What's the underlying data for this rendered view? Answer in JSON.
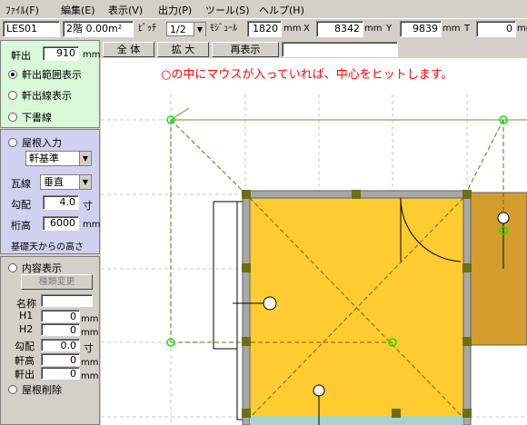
{
  "menu": {
    "file": "ﾌｧｲﾙ(F)",
    "edit": "編集(E)",
    "view": "表示(V)",
    "output": "出力(P)",
    "tools": "ツール(S)",
    "help": "ヘルプ(H)"
  },
  "status": {
    "layer": "LES01",
    "floor": "2階 0.00m²",
    "pitch_label": "ﾋﾟｯﾁ",
    "pitch_value": "1/2",
    "module_label": "ﾓｼﾞｭｰﾙ",
    "module_value": "1820",
    "x_label": "X",
    "x_value": "8342",
    "y_label": "Y",
    "y_value": "9839",
    "t_label": "T",
    "t_value": "0",
    "unit": "mm"
  },
  "toolbar": {
    "all": "全 体",
    "zoom": "拡 大",
    "redraw": "再表示"
  },
  "panel1": {
    "eave_label": "軒出",
    "eave_value": "910",
    "unit": "mm",
    "opt_range": "軒出範囲表示",
    "opt_line": "軒出線表示",
    "opt_draft": "下書線"
  },
  "panel2": {
    "roof_input": "屋根入力",
    "base_select": "軒基準",
    "tile_label": "瓦線",
    "tile_select": "垂直",
    "slope_label": "勾配",
    "slope_value": "4.0",
    "slope_unit": "寸",
    "beam_label": "桁高",
    "beam_value": "6000",
    "beam_unit": "mm",
    "note": "基礎天からの高さ"
  },
  "panel3": {
    "content_display": "内容表示",
    "change_type": "種類変更",
    "name_label": "名称",
    "h1_label": "H1",
    "h1_value": "0",
    "h2_label": "H2",
    "h2_value": "0",
    "slope_label": "勾配",
    "slope_value": "0.0",
    "slope_unit": "寸",
    "beam_label": "軒高",
    "beam_value": "0",
    "eave_label": "軒出",
    "eave_value": "0",
    "unit": "mm",
    "delete_roof": "屋根削除"
  },
  "canvas": {
    "hint": "○の中にマウスが入っていれば、中心をヒットします。",
    "colors": {
      "roof": "#fecb30",
      "roof_dark": "#d39c2c",
      "guide": "#6b8e23",
      "node": "#00ee00",
      "hint": "#ff0000"
    }
  }
}
